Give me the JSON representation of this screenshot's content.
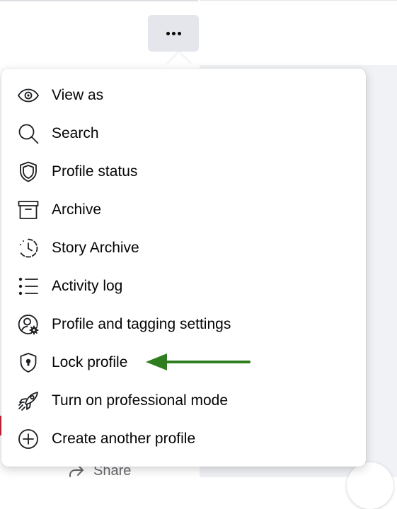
{
  "more_button": {
    "icon": "more-horizontal-icon"
  },
  "menu": {
    "items": [
      {
        "label": "View as",
        "icon": "eye-icon"
      },
      {
        "label": "Search",
        "icon": "search-icon"
      },
      {
        "label": "Profile status",
        "icon": "shield-icon"
      },
      {
        "label": "Archive",
        "icon": "archive-box-icon"
      },
      {
        "label": "Story Archive",
        "icon": "story-archive-clock-icon"
      },
      {
        "label": "Activity log",
        "icon": "list-icon"
      },
      {
        "label": "Profile and tagging settings",
        "icon": "profile-gear-icon"
      },
      {
        "label": "Lock profile",
        "icon": "lock-shield-icon"
      },
      {
        "label": "Turn on professional mode",
        "icon": "professional-rocket-icon"
      },
      {
        "label": "Create another profile",
        "icon": "plus-circle-icon"
      }
    ]
  },
  "annotation": {
    "arrow_color": "#2e7d1e",
    "icon": "arrow-left-icon"
  },
  "background": {
    "share_label": "Share",
    "share_icon": "share-icon"
  },
  "colors": {
    "button_bg": "#e4e6eb",
    "text": "#050505",
    "icon": "#65676b",
    "page_bg_right": "#f0f2f5"
  }
}
